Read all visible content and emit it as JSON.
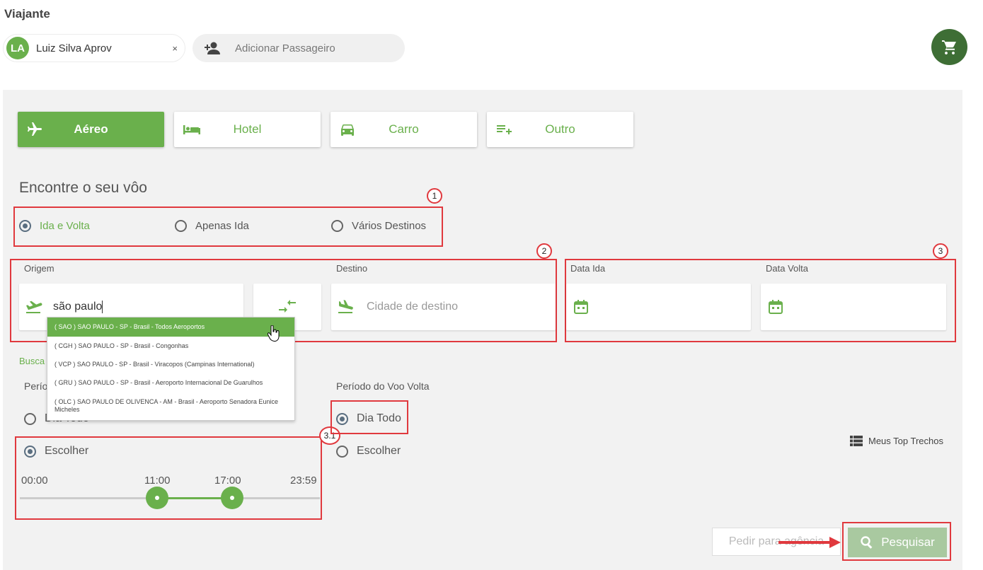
{
  "traveler": {
    "section_title": "Viajante",
    "initials": "LA",
    "name": "Luiz Silva Aprov",
    "remove": "×",
    "add_passenger": "Adicionar Passageiro"
  },
  "tabs": [
    {
      "label": "Aéreo",
      "icon": "airplane-icon",
      "active": true
    },
    {
      "label": "Hotel",
      "icon": "bed-icon",
      "active": false
    },
    {
      "label": "Carro",
      "icon": "car-icon",
      "active": false
    },
    {
      "label": "Outro",
      "icon": "playlist-add-icon",
      "active": false
    }
  ],
  "search": {
    "title": "Encontre o seu vôo",
    "trip_types": [
      {
        "label": "Ida e Volta",
        "checked": true
      },
      {
        "label": "Apenas Ida",
        "checked": false
      },
      {
        "label": "Vários Destinos",
        "checked": false
      }
    ],
    "origin_label": "Origem",
    "origin_value": "são paulo",
    "destination_label": "Destino",
    "destination_placeholder": "Cidade de destino",
    "date_out_label": "Data Ida",
    "date_return_label": "Data Volta",
    "busca_label": "Busca",
    "period_out_label": "Perío",
    "period_return_label": "Período do Voo Volta",
    "period_out_options": [
      {
        "label": "Dia Todo",
        "checked": false
      },
      {
        "label": "Escolher",
        "checked": true
      }
    ],
    "period_return_options": [
      {
        "label": "Dia Todo",
        "checked": true
      },
      {
        "label": "Escolher",
        "checked": false
      }
    ],
    "slider": {
      "min_label": "00:00",
      "max_label": "23:59",
      "low_label": "11:00",
      "high_label": "17:00",
      "low_fraction": 0.458,
      "high_fraction": 0.708
    },
    "top_trechos": "Meus Top Trechos",
    "pedir_button": "Pedir para agência",
    "search_button": "Pesquisar"
  },
  "suggestions": [
    "( SAO ) SAO PAULO - SP - Brasil - Todos Aeroportos",
    "( CGH ) SAO PAULO - SP - Brasil - Congonhas",
    "( VCP ) SAO PAULO - SP - Brasil - Viracopos (Campinas International)",
    "( GRU ) SAO PAULO - SP - Brasil - Aeroporto Internacional De Guarulhos",
    "( OLC ) SAO PAULO DE OLIVENCA - AM - Brasil - Aeroporto Senadora Eunice Micheles"
  ],
  "annotations": [
    "1",
    "2",
    "3",
    "3.1"
  ],
  "colors": {
    "accent": "#6ab04c",
    "cart": "#3e6e35",
    "annotation": "#e0393e",
    "search_button": "#a9c9a0"
  }
}
